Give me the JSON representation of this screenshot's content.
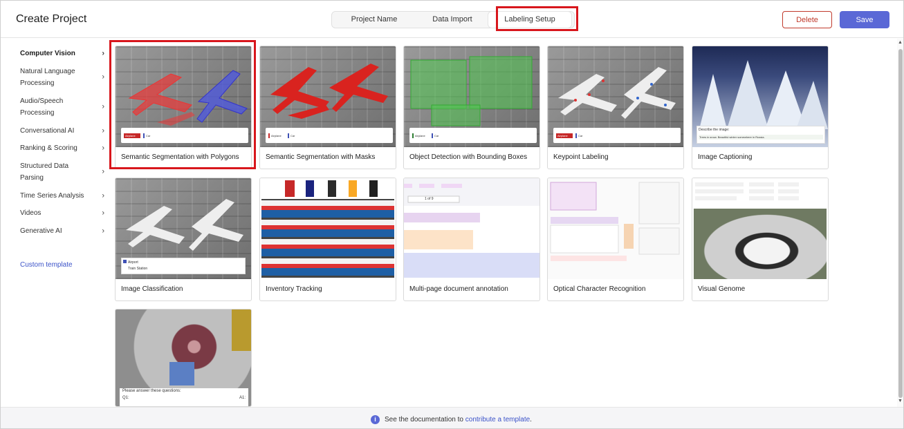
{
  "header": {
    "title": "Create Project",
    "tabs": [
      {
        "label": "Project Name"
      },
      {
        "label": "Data Import"
      },
      {
        "label": "Labeling Setup",
        "active": true
      }
    ],
    "delete_label": "Delete",
    "save_label": "Save"
  },
  "colors": {
    "accent": "#5a68d6",
    "highlight": "#d8161c",
    "danger": "#c0392b",
    "link": "#3b52c8"
  },
  "sidebar": {
    "items": [
      {
        "label": "Computer Vision",
        "icon": "chevron-right-icon",
        "active": true
      },
      {
        "label": "Natural Language Processing",
        "icon": "chevron-right-icon"
      },
      {
        "label": "Audio/Speech Processing",
        "icon": "chevron-right-icon"
      },
      {
        "label": "Conversational AI",
        "icon": "chevron-right-icon"
      },
      {
        "label": "Ranking & Scoring",
        "icon": "chevron-right-icon"
      },
      {
        "label": "Structured Data Parsing",
        "icon": "chevron-right-icon"
      },
      {
        "label": "Time Series Analysis",
        "icon": "chevron-right-icon"
      },
      {
        "label": "Videos",
        "icon": "chevron-right-icon"
      },
      {
        "label": "Generative AI",
        "icon": "chevron-right-icon"
      }
    ],
    "custom_template": "Custom template"
  },
  "templates": [
    {
      "label": "Semantic Segmentation with Polygons",
      "selected": true,
      "tags": [
        "Airplane",
        "Car"
      ]
    },
    {
      "label": "Semantic Segmentation with Masks",
      "tags": [
        "Airplane",
        "Car"
      ]
    },
    {
      "label": "Object Detection with Bounding Boxes",
      "tags": [
        "Airplane",
        "Car"
      ]
    },
    {
      "label": "Keypoint Labeling",
      "tags": [
        "Airplane",
        "Car"
      ]
    },
    {
      "label": "Image Captioning",
      "caption_prompt": "Describe the image:",
      "caption_text": "Trees in snow. Beautiful winter somewhere in Russia."
    },
    {
      "label": "Image Classification",
      "options": [
        "Airport",
        "Train Station"
      ]
    },
    {
      "label": "Inventory Tracking"
    },
    {
      "label": "Multi-page document annotation",
      "page_text": "1 of 9"
    },
    {
      "label": "Optical Character Recognition"
    },
    {
      "label": "Visual Genome"
    },
    {
      "label": "",
      "question_prompt": "Please answer these questions:",
      "q1": "Q1:",
      "a1": "A1:"
    }
  ],
  "footer": {
    "text": "See the documentation to ",
    "link": "contribute a template",
    "suffix": ".",
    "icon": "info-icon"
  }
}
